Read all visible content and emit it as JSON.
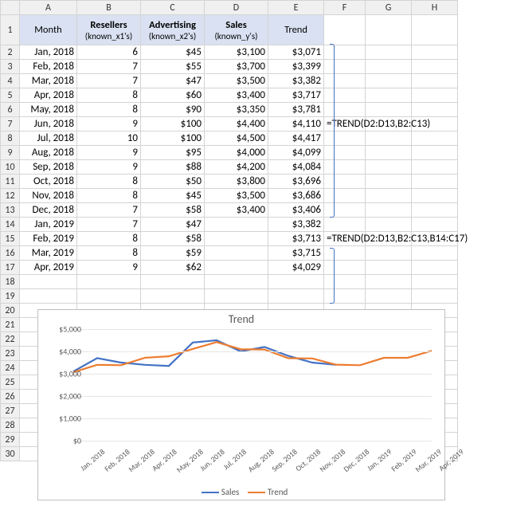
{
  "columns": [
    "A",
    "B",
    "C",
    "D",
    "E",
    "F",
    "G",
    "H"
  ],
  "header": {
    "month": "Month",
    "resellers": "Resellers",
    "resellers_sub": "(known_x1's)",
    "advertising": "Advertising",
    "advertising_sub": "(known_x2's)",
    "sales": "Sales",
    "sales_sub": "(known_y's)",
    "trend": "Trend"
  },
  "rows": [
    {
      "n": 2,
      "month": "Jan, 2018",
      "res": "6",
      "adv": "$45",
      "sales": "$3,100",
      "trend": "$3,071"
    },
    {
      "n": 3,
      "month": "Feb, 2018",
      "res": "7",
      "adv": "$55",
      "sales": "$3,700",
      "trend": "$3,399"
    },
    {
      "n": 4,
      "month": "Mar, 2018",
      "res": "7",
      "adv": "$47",
      "sales": "$3,500",
      "trend": "$3,382"
    },
    {
      "n": 5,
      "month": "Apr, 2018",
      "res": "8",
      "adv": "$60",
      "sales": "$3,400",
      "trend": "$3,717"
    },
    {
      "n": 6,
      "month": "May, 2018",
      "res": "8",
      "adv": "$90",
      "sales": "$3,350",
      "trend": "$3,781"
    },
    {
      "n": 7,
      "month": "Jun, 2018",
      "res": "9",
      "adv": "$100",
      "sales": "$4,400",
      "trend": "$4,110",
      "formula": "=TREND(D2:D13,B2:C13)"
    },
    {
      "n": 8,
      "month": "Jul, 2018",
      "res": "10",
      "adv": "$100",
      "sales": "$4,500",
      "trend": "$4,417"
    },
    {
      "n": 9,
      "month": "Aug, 2018",
      "res": "9",
      "adv": "$95",
      "sales": "$4,000",
      "trend": "$4,099"
    },
    {
      "n": 10,
      "month": "Sep, 2018",
      "res": "9",
      "adv": "$88",
      "sales": "$4,200",
      "trend": "$4,084"
    },
    {
      "n": 11,
      "month": "Oct, 2018",
      "res": "8",
      "adv": "$50",
      "sales": "$3,800",
      "trend": "$3,696"
    },
    {
      "n": 12,
      "month": "Nov, 2018",
      "res": "8",
      "adv": "$45",
      "sales": "$3,500",
      "trend": "$3,686"
    },
    {
      "n": 13,
      "month": "Dec, 2018",
      "res": "7",
      "adv": "$58",
      "sales": "$3,400",
      "trend": "$3,406"
    },
    {
      "n": 14,
      "month": "Jan, 2019",
      "res": "7",
      "adv": "$47",
      "sales": "",
      "trend": "$3,382"
    },
    {
      "n": 15,
      "month": "Feb, 2019",
      "res": "8",
      "adv": "$58",
      "sales": "",
      "trend": "$3,713",
      "formula": "=TREND(D2:D13,B2:C13,B14:C17)"
    },
    {
      "n": 16,
      "month": "Mar, 2019",
      "res": "8",
      "adv": "$59",
      "sales": "",
      "trend": "$3,715"
    },
    {
      "n": 17,
      "month": "Apr, 2019",
      "res": "9",
      "adv": "$62",
      "sales": "",
      "trend": "$4,029"
    }
  ],
  "empty_rows": [
    18,
    19,
    20,
    21,
    22,
    23,
    24,
    25,
    26,
    27,
    28,
    29,
    30
  ],
  "chart_data": {
    "type": "line",
    "title": "Trend",
    "ylabel": "",
    "xlabel": "",
    "ylim": [
      0,
      5000
    ],
    "yticks": [
      "$0",
      "$1,000",
      "$2,000",
      "$3,000",
      "$4,000",
      "$5,000"
    ],
    "categories": [
      "Jan, 2018",
      "Feb, 2018",
      "Mar, 2018",
      "Apr, 2018",
      "May, 2018",
      "Jun, 2018",
      "Jul, 2018",
      "Aug, 2018",
      "Sep, 2018",
      "Oct, 2018",
      "Nov, 2018",
      "Dec, 2018",
      "Jan, 2019",
      "Feb, 2019",
      "Mar, 2019",
      "Apr, 2019"
    ],
    "series": [
      {
        "name": "Sales",
        "color": "#4472c4",
        "values": [
          3100,
          3700,
          3500,
          3400,
          3350,
          4400,
          4500,
          4000,
          4200,
          3800,
          3500,
          3400,
          null,
          null,
          null,
          null
        ]
      },
      {
        "name": "Trend",
        "color": "#ed7d31",
        "values": [
          3071,
          3399,
          3382,
          3717,
          3781,
          4110,
          4417,
          4099,
          4084,
          3696,
          3686,
          3406,
          3382,
          3713,
          3715,
          4029
        ]
      }
    ]
  }
}
